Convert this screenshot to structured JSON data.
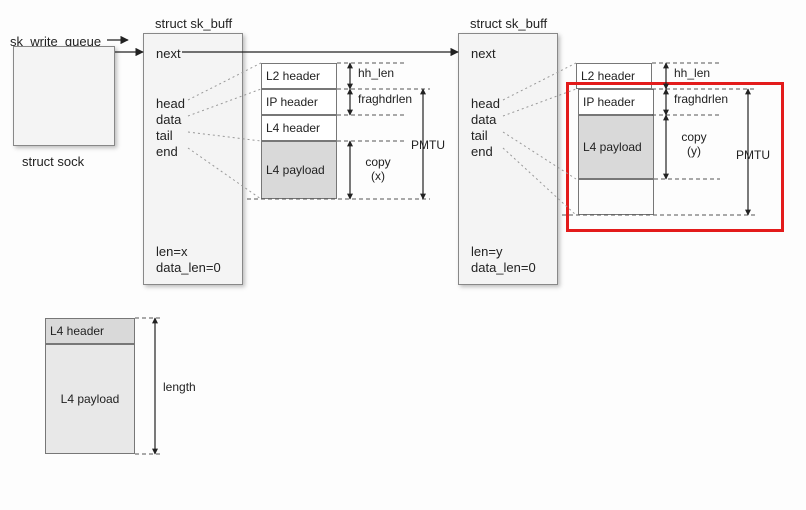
{
  "sock": {
    "field": "sk_write_queue",
    "caption": "struct sock"
  },
  "skb1": {
    "title": "struct sk_buff",
    "fields": {
      "next": "next",
      "head": "head",
      "data": "data",
      "tail": "tail",
      "end": "end"
    },
    "len": "len=x",
    "data_len": "data_len=0",
    "headers": {
      "l2": "L2 header",
      "ip": "IP header",
      "l4h": "L4 header",
      "l4p": "L4 payload"
    },
    "dims": {
      "hh": "hh_len",
      "frag": "fraghdrlen",
      "copy": "copy\n(x)",
      "pmtu": "PMTU"
    }
  },
  "skb2": {
    "title": "struct sk_buff",
    "fields": {
      "next": "next",
      "head": "head",
      "data": "data",
      "tail": "tail",
      "end": "end"
    },
    "len": "len=y",
    "data_len": "data_len=0",
    "headers": {
      "l2": "L2 header",
      "ip": "IP header",
      "l4p": "L4 payload"
    },
    "dims": {
      "hh": "hh_len",
      "frag": "fraghdrlen",
      "copy": "copy\n(y)",
      "pmtu": "PMTU"
    }
  },
  "bottom": {
    "l4h": "L4 header",
    "l4p": "L4 payload",
    "length": "length"
  }
}
